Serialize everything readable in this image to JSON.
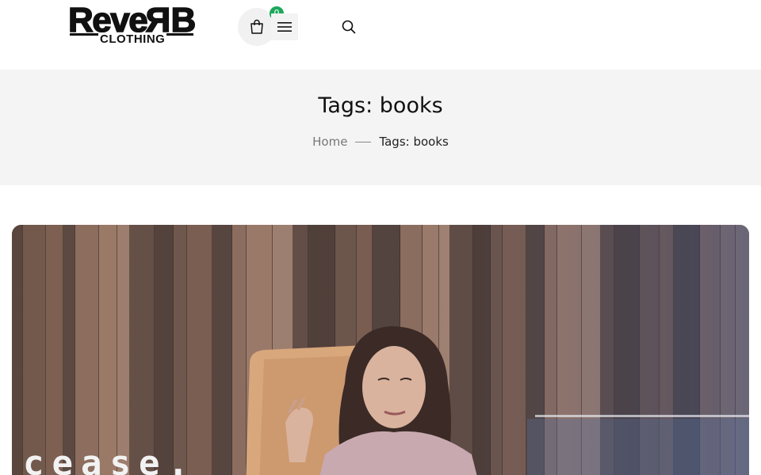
{
  "header": {
    "logo": {
      "word_prefix": "Reve",
      "word_suffix": "B",
      "word_mirrored": "R",
      "subtitle": "CLOTHING"
    },
    "cart": {
      "count": "0",
      "icon": "shopping-bag-icon"
    },
    "menu": {
      "icon": "hamburger-menu-icon"
    },
    "search": {
      "icon": "search-icon"
    }
  },
  "title_band": {
    "title": "Tags: books",
    "breadcrumb": {
      "home": "Home",
      "current": "Tags: books"
    }
  },
  "featured_post": {
    "image_overlay_text": "cease.",
    "colors": {
      "wood_dark": "#4a3a33",
      "wood_light": "#a07e6a",
      "chair": "#d9a77c",
      "blue_tint": "#5a6f9a"
    }
  },
  "colors": {
    "badge": "#1ba85b",
    "band_bg": "#f4f4f4",
    "breadcrumb_home": "#777777"
  }
}
